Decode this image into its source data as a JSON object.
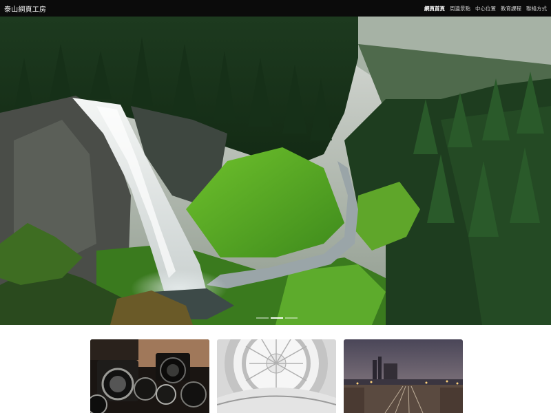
{
  "header": {
    "brand": "泰山網頁工房",
    "nav": [
      {
        "label": "網頁首頁",
        "active": true
      },
      {
        "label": "周邊景點",
        "active": false
      },
      {
        "label": "中心位置",
        "active": false
      },
      {
        "label": "教育課程",
        "active": false
      },
      {
        "label": "聯絡方式",
        "active": false
      }
    ]
  },
  "hero": {
    "image": "waterfall-forest-photo",
    "carousel": {
      "slides": 3,
      "active_index": 1
    }
  },
  "thumbnails": [
    {
      "image": "vintage-cameras-photo"
    },
    {
      "image": "glass-dome-ceiling-photo"
    },
    {
      "image": "railway-city-night-photo"
    }
  ],
  "colors": {
    "navbar_bg": "#0b0b0b",
    "page_bg": "#ffffff"
  }
}
